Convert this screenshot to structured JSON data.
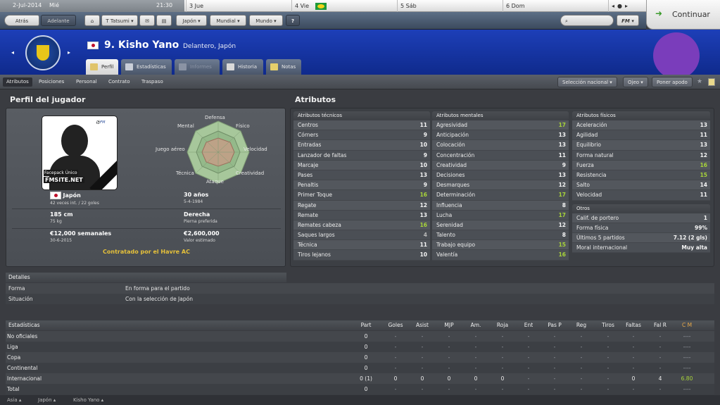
{
  "calendar": {
    "current_date": "2-Jul-2014",
    "current_day": "Mié",
    "time": "21:30",
    "days": [
      "3 Jue",
      "4 Vie",
      "5 Sáb",
      "6 Dom"
    ],
    "continue_label": "Continuar"
  },
  "toolbar": {
    "back": "Atrás",
    "forward": "Adelante",
    "manager": "T Tatsumi",
    "menus": [
      "Japón",
      "Mundial",
      "Mundo"
    ],
    "help": "?",
    "fm": "FM"
  },
  "player": {
    "number_name": "9. Kisho Yano",
    "subtitle": "Delantero, Japón"
  },
  "tabs": [
    "Perfil",
    "Estadísticas",
    "Informes",
    "Historia",
    "Notas"
  ],
  "subnav": {
    "items": [
      "Atributos",
      "Posiciones",
      "Personal",
      "Contrato",
      "Traspaso"
    ],
    "buttons": [
      "Selección nacional",
      "Ojeo",
      "Poner apodo"
    ]
  },
  "profile": {
    "title": "Perfil del jugador",
    "photo_caption1": "Facepack Único",
    "photo_caption2": "FMSITE.NET",
    "radar_labels": [
      "Defensa",
      "Físico",
      "Velocidad",
      "Creatividad",
      "Ataque",
      "Técnica",
      "Juego aéreo",
      "Mental"
    ],
    "nation": "Japón",
    "caps": "42 veces int. / 22 goles",
    "age": "30 años",
    "dob": "5-4-1984",
    "height": "185 cm",
    "weight": "75 kg",
    "foot": "Derecha",
    "foot_label": "Pierna preferida",
    "wage": "€12,000 semanales",
    "wage_until": "30-6-2015",
    "value": "€2,600,000",
    "value_label": "Valor estimado",
    "contract": "Contratado por el Havre AC"
  },
  "attributes_title": "Atributos",
  "technical": {
    "title": "Atributos técnicos",
    "rows": [
      [
        "Centros",
        "11"
      ],
      [
        "Córners",
        "9"
      ],
      [
        "Entradas",
        "10"
      ],
      [
        "Lanzador de faltas",
        "9"
      ],
      [
        "Marcaje",
        "10"
      ],
      [
        "Pases",
        "13"
      ],
      [
        "Penaltis",
        "9"
      ],
      [
        "Primer Toque",
        "16"
      ],
      [
        "Regate",
        "12"
      ],
      [
        "Remate",
        "13"
      ],
      [
        "Remates cabeza",
        "16"
      ],
      [
        "Saques largos",
        "4"
      ],
      [
        "Técnica",
        "11"
      ],
      [
        "Tiros lejanos",
        "10"
      ]
    ]
  },
  "mental": {
    "title": "Atributos mentales",
    "rows": [
      [
        "Agresividad",
        "17"
      ],
      [
        "Anticipación",
        "13"
      ],
      [
        "Colocación",
        "13"
      ],
      [
        "Concentración",
        "11"
      ],
      [
        "Creatividad",
        "9"
      ],
      [
        "Decisiones",
        "13"
      ],
      [
        "Desmarques",
        "12"
      ],
      [
        "Determinación",
        "17"
      ],
      [
        "Influencia",
        "8"
      ],
      [
        "Lucha",
        "17"
      ],
      [
        "Serenidad",
        "12"
      ],
      [
        "Talento",
        "8"
      ],
      [
        "Trabajo equipo",
        "15"
      ],
      [
        "Valentía",
        "16"
      ]
    ]
  },
  "physical": {
    "title": "Atributos físicos",
    "rows": [
      [
        "Aceleración",
        "13"
      ],
      [
        "Agilidad",
        "11"
      ],
      [
        "Equilibrio",
        "13"
      ],
      [
        "Forma natural",
        "12"
      ],
      [
        "Fuerza",
        "16"
      ],
      [
        "Resistencia",
        "15"
      ],
      [
        "Salto",
        "14"
      ],
      [
        "Velocidad",
        "11"
      ]
    ]
  },
  "others": {
    "title": "Otros",
    "rows": [
      [
        "Calif. de portero",
        "1"
      ],
      [
        "Forma física",
        "99%"
      ],
      [
        "Últimos 5 partidos",
        "7.12 (2 gls)"
      ],
      [
        "Moral internacional",
        "Muy alta"
      ]
    ]
  },
  "details": {
    "title": "Detalles",
    "rows": [
      [
        "Forma",
        "En forma para el partido"
      ],
      [
        "Situación",
        "Con la selección de Japón"
      ]
    ]
  },
  "stats": {
    "title": "Estadísticas",
    "columns": [
      "Part",
      "Goles",
      "Asist",
      "MJP",
      "Am.",
      "Roja",
      "Ent",
      "Pas P",
      "Reg",
      "Tiros",
      "Faltas",
      "Fal R",
      "C M"
    ],
    "rows": [
      {
        "label": "No oficiales",
        "values": [
          "0",
          "-",
          "-",
          "-",
          "-",
          "-",
          "-",
          "-",
          "-",
          "-",
          "-",
          "-",
          "----"
        ]
      },
      {
        "label": "Liga",
        "values": [
          "0",
          "-",
          "-",
          "-",
          "-",
          "-",
          "-",
          "-",
          "-",
          "-",
          "-",
          "-",
          "----"
        ]
      },
      {
        "label": "Copa",
        "values": [
          "0",
          "-",
          "-",
          "-",
          "-",
          "-",
          "-",
          "-",
          "-",
          "-",
          "-",
          "-",
          "----"
        ]
      },
      {
        "label": "Continental",
        "values": [
          "0",
          "-",
          "-",
          "-",
          "-",
          "-",
          "-",
          "-",
          "-",
          "-",
          "-",
          "-",
          "----"
        ]
      },
      {
        "label": "Internacional",
        "values": [
          "0 (1)",
          "0",
          "0",
          "0",
          "0",
          "0",
          "-",
          "-",
          "-",
          "-",
          "0",
          "4",
          "6.80"
        ]
      },
      {
        "label": "Total",
        "values": [
          "0",
          "-",
          "-",
          "-",
          "-",
          "-",
          "-",
          "-",
          "-",
          "-",
          "-",
          "-",
          "----"
        ]
      }
    ]
  },
  "footer": [
    "Asia",
    "Japón",
    "Kisho Yano"
  ]
}
